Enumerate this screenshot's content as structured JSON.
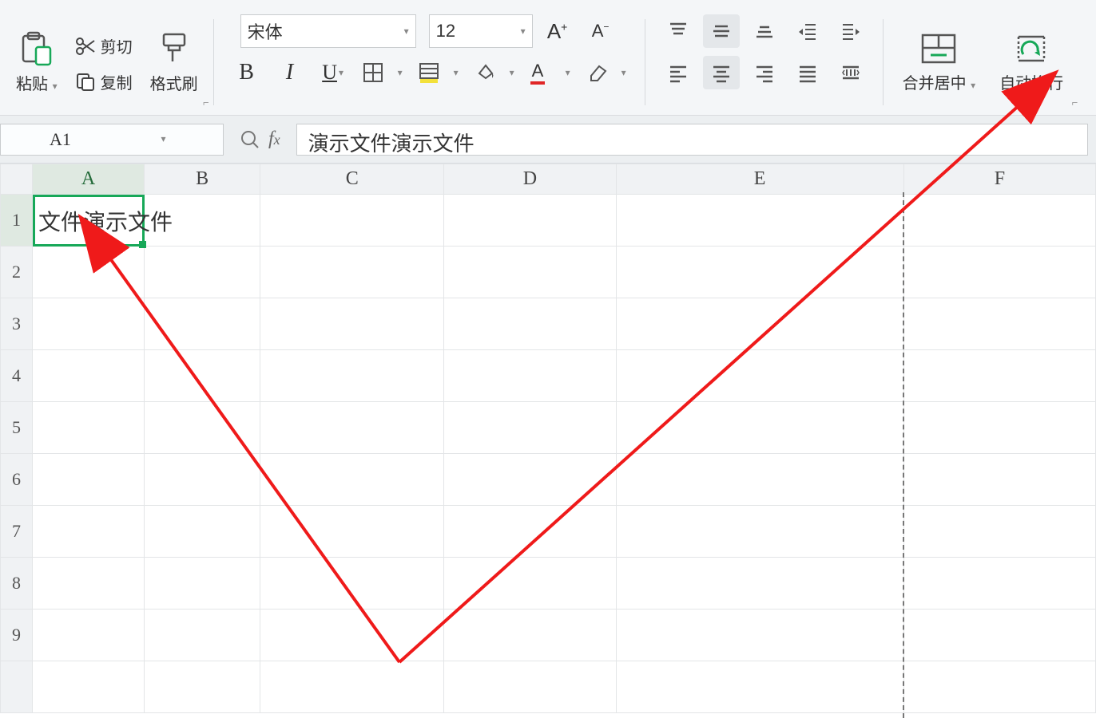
{
  "ribbon": {
    "paste": "粘贴",
    "cut": "剪切",
    "copy": "复制",
    "format_painter": "格式刷",
    "font_name": "宋体",
    "font_size": "12",
    "merge_center": "合并居中",
    "wrap_text": "自动换行"
  },
  "name_box": "A1",
  "formula_bar": "演示文件演示文件",
  "columns": [
    "A",
    "B",
    "C",
    "D",
    "E",
    "F"
  ],
  "rows": [
    "1",
    "2",
    "3",
    "4",
    "5",
    "6",
    "7",
    "8",
    "9"
  ],
  "cell_a1_display": "文件演示文件"
}
